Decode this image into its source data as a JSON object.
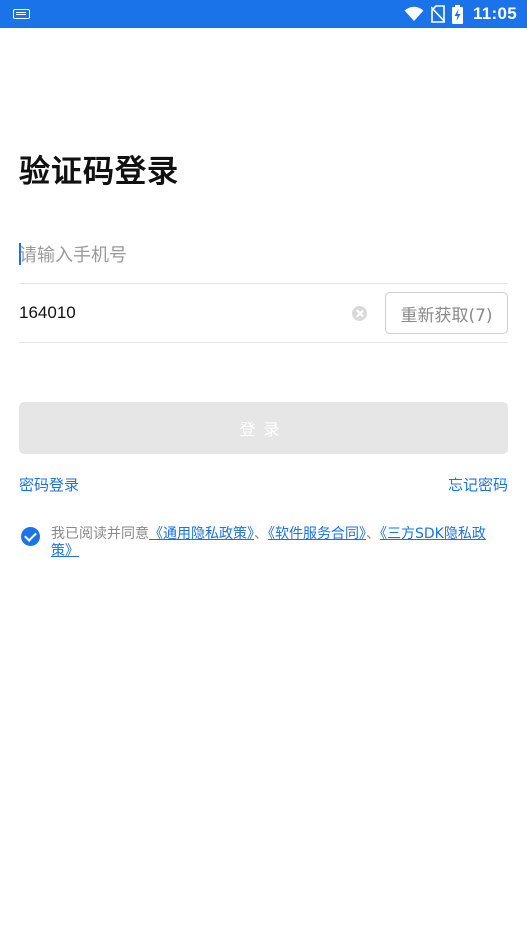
{
  "status_bar": {
    "time": "11:05",
    "icons": [
      "keyboard-icon",
      "wifi-icon",
      "no-sim-icon",
      "battery-charging-icon"
    ]
  },
  "page": {
    "title": "验证码登录"
  },
  "phone": {
    "placeholder": "请输入手机号",
    "value": ""
  },
  "code": {
    "value": "164010",
    "resend_label": "重新获取(7)"
  },
  "login_button": {
    "label": "登录"
  },
  "links": {
    "password_login": "密码登录",
    "forgot_password": "忘记密码"
  },
  "agreement": {
    "checked": true,
    "prefix": "我已阅读并同意",
    "policy_general": "《通用隐私政策》",
    "sep1": "、",
    "policy_software": "《软件服务合同》",
    "sep2": "、",
    "policy_sdk": "《三方SDK隐私政策》"
  },
  "colors": {
    "accent": "#1a73e8",
    "button_disabled": "#e6e6e6",
    "placeholder": "#9a9a9a"
  }
}
